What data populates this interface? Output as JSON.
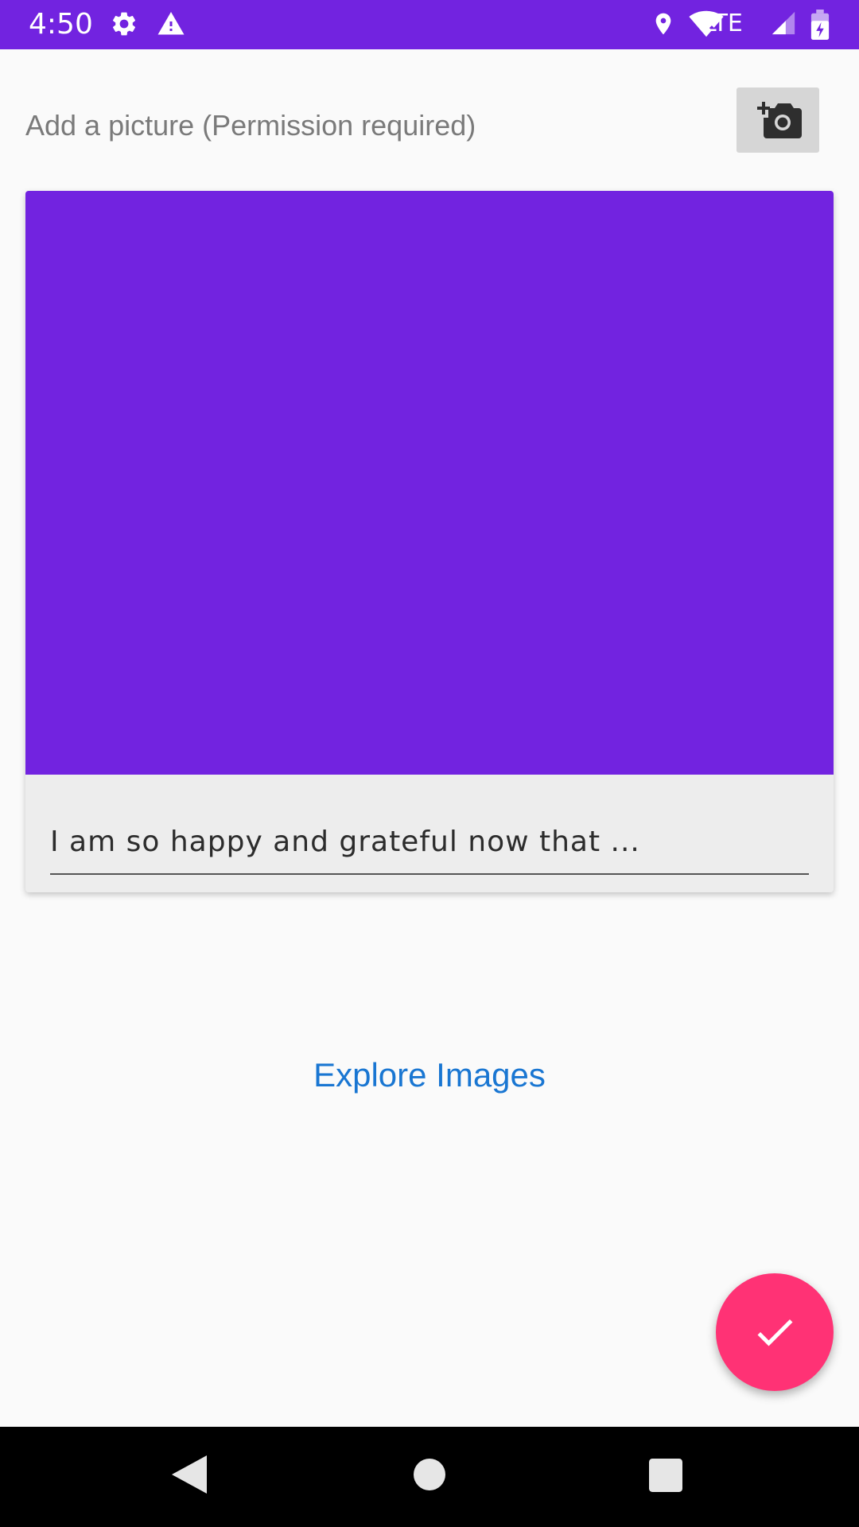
{
  "status_bar": {
    "time": "4:50",
    "network": "LTE",
    "background_color": "#7223E0",
    "icons": [
      "settings-icon",
      "warning-icon",
      "location-icon",
      "wifi-icon",
      "signal-icon",
      "battery-charging-icon"
    ]
  },
  "header": {
    "add_picture_label": "Add a picture (Permission required)",
    "add_photo_icon": "add-a-photo-icon"
  },
  "card": {
    "image_color": "#7223E0",
    "input_placeholder": "I am so happy and grateful now that ..."
  },
  "explore_link": "Explore Images",
  "fab": {
    "icon": "check-icon",
    "color": "#FF3275"
  },
  "nav_bar": {
    "buttons": [
      "back-icon",
      "home-icon",
      "recents-icon"
    ]
  }
}
